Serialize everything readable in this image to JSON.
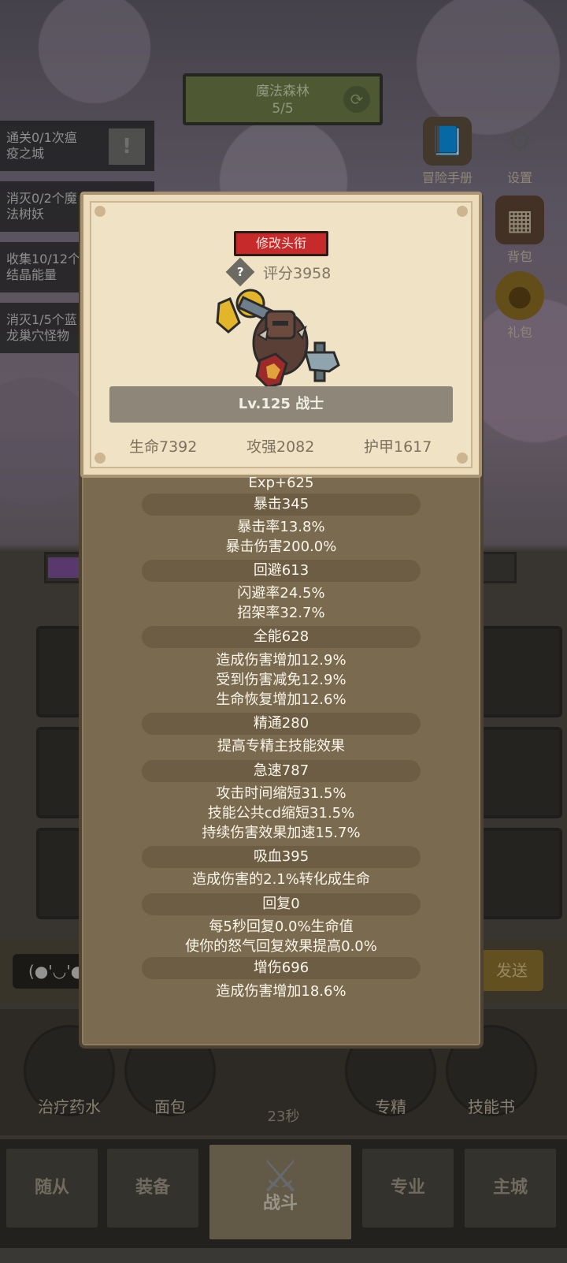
{
  "background": {
    "zone": {
      "name": "魔法森林",
      "progress": "5/5"
    },
    "quests": [
      {
        "label": "通关0/1次瘟\n疫之城"
      },
      {
        "label": "消灭0/2个魔\n法树妖"
      },
      {
        "label": "收集10/12个\n结晶能量"
      },
      {
        "label": "消灭1/5个蓝\n龙巢穴怪物"
      }
    ],
    "side_buttons": [
      {
        "label": "冒险手册",
        "icon": "book-icon"
      },
      {
        "label": "设置",
        "icon": "gear-icon"
      },
      {
        "label": "背包",
        "icon": "bag-icon"
      },
      {
        "label": "礼包",
        "icon": "coin-icon"
      }
    ],
    "chat": {
      "emote": "(●'◡'●",
      "send_label": "发送"
    },
    "skills": [
      {
        "label": "治疗药水"
      },
      {
        "label": "面包"
      },
      {
        "label": "专精"
      },
      {
        "label": "技能书"
      }
    ],
    "timer": "23秒",
    "tabs": [
      {
        "label": "随从"
      },
      {
        "label": "装备"
      },
      {
        "label": "战斗"
      },
      {
        "label": "专业"
      },
      {
        "label": "主城"
      }
    ]
  },
  "popup": {
    "rename_label": "修改头衔",
    "score": "评分3958",
    "level_class": "Lv.125 战士",
    "base_stats": {
      "hp": "生命7392",
      "attack": "攻强2082",
      "armor": "护甲1617"
    },
    "exp": "Exp+625",
    "stat_groups": [
      {
        "title": "暴击345",
        "lines": [
          "暴击率13.8%",
          "暴击伤害200.0%"
        ]
      },
      {
        "title": "回避613",
        "lines": [
          "闪避率24.5%",
          "招架率32.7%"
        ]
      },
      {
        "title": "全能628",
        "lines": [
          "造成伤害增加12.9%",
          "受到伤害减免12.9%",
          "生命恢复增加12.6%"
        ]
      },
      {
        "title": "精通280",
        "lines": [
          "提高专精主技能效果"
        ]
      },
      {
        "title": "急速787",
        "lines": [
          "攻击时间缩短31.5%",
          "技能公共cd缩短31.5%",
          "持续伤害效果加速15.7%"
        ]
      },
      {
        "title": "吸血395",
        "lines": [
          "造成伤害的2.1%转化成生命"
        ]
      },
      {
        "title": "回复0",
        "lines": [
          "每5秒回复0.0%生命值",
          "使你的怒气回复效果提高0.0%"
        ]
      },
      {
        "title": "增伤696",
        "lines": [
          "造成伤害增加18.6%"
        ]
      }
    ]
  },
  "colors": {
    "rename_button": "#c62a2a",
    "panel": "#7a6a4f",
    "card": "#f0e2c4"
  }
}
